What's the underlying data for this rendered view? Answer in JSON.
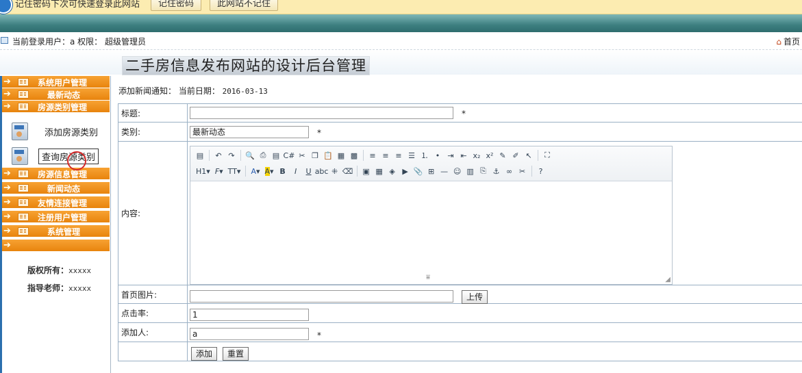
{
  "notify": {
    "message": "记住密码下次可快速登录此网站",
    "btn_remember": "记住密码",
    "btn_never": "此网站不记住"
  },
  "userbar": {
    "text": "当前登录用户：a 权限： 超级管理员",
    "home": "首页"
  },
  "page_title": "二手房信息发布网站的设计后台管理",
  "sidebar": {
    "items": [
      {
        "label": "系统用户管理"
      },
      {
        "label": "最新动态"
      },
      {
        "label": "房源类别管理"
      },
      {
        "label": "房源信息管理"
      },
      {
        "label": "新闻动态"
      },
      {
        "label": "友情连接管理"
      },
      {
        "label": "注册用户管理"
      },
      {
        "label": "系统管理"
      }
    ],
    "sub_items": [
      {
        "label": "添加房源类别"
      },
      {
        "label": "查询房源类别"
      }
    ],
    "copyright_label": "版权所有：",
    "copyright_value": "xxxxx",
    "advisor_label": "指导老师：",
    "advisor_value": "xxxxx"
  },
  "crumb": {
    "text": "添加新闻通知： 当前日期：",
    "date": "2016-03-13"
  },
  "form": {
    "title_label": "标题:",
    "title_value": "",
    "category_label": "类别:",
    "category_value": "最新动态",
    "content_label": "内容:",
    "image_label": "首页图片:",
    "image_value": "",
    "upload_button": "上传",
    "clicks_label": "点击率:",
    "clicks_value": "1",
    "adder_label": "添加人:",
    "adder_value": "a",
    "required_mark": "*",
    "submit_button": "添加",
    "reset_button": "重置"
  },
  "editor": {
    "heading_menu": "H1",
    "font_menu": "F",
    "size_menu": "TT",
    "font_color": "A",
    "bg_color": "A",
    "bold": "B",
    "italic": "I",
    "underline": "U"
  }
}
